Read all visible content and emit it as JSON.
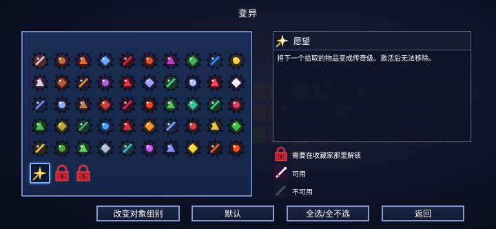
{
  "header": {
    "title": "变异"
  },
  "mutations": [
    [
      "dagger",
      "#c9c9d6",
      "#5a2a2a"
    ],
    [
      "pickaxe",
      "#c06a3a",
      "#3a1c2a"
    ],
    [
      "flame-axe",
      "#e07030",
      "#3a1a2a"
    ],
    [
      "sword-x",
      "#6aa8ff",
      "#1a2a4a"
    ],
    [
      "rune",
      "#d03040",
      "#3a1020"
    ],
    [
      "potion",
      "#e05030",
      "#3a1a1a"
    ],
    [
      "bow",
      "#c040c0",
      "#2a1a3a"
    ],
    [
      "orb",
      "#40b050",
      "#1a3a2a"
    ],
    [
      "shield",
      "#3a80ff",
      "#1a2a4a"
    ],
    [
      "bolt",
      "#ffd040",
      "#3a2a1a"
    ],
    [
      "fist",
      "#d8d8e0",
      "#3a1a3a"
    ],
    [
      "crossbow",
      "#b05a30",
      "#3a1a1a"
    ],
    [
      "gear",
      "#e09030",
      "#2a1a2a"
    ],
    [
      "axe",
      "#b060e0",
      "#2a1a3a"
    ],
    [
      "star",
      "#e03040",
      "#3a1020"
    ],
    [
      "claw",
      "#a0a0ff",
      "#1a1a3a"
    ],
    [
      "flask",
      "#40d080",
      "#1a3a2a"
    ],
    [
      "wings",
      "#b0c0ff",
      "#1a1a3a"
    ],
    [
      "target",
      "#ff4060",
      "#3a1020"
    ],
    [
      "skull",
      "#f0f0f0",
      "#2a1a3a"
    ],
    [
      "blade",
      "#6a90ff",
      "#1a2040"
    ],
    [
      "grenade",
      "#8ab0ff",
      "#1a2040"
    ],
    [
      "spear",
      "#c08050",
      "#2a1a2a"
    ],
    [
      "mask",
      "#d04040",
      "#3a1a1a"
    ],
    [
      "flame",
      "#d03060",
      "#3a1020"
    ],
    [
      "eye",
      "#ff4030",
      "#2a1a1a"
    ],
    [
      "skull-2",
      "#60c060",
      "#1a3a2a"
    ],
    [
      "tome",
      "#3ac0a0",
      "#1a3a3a"
    ],
    [
      "gem",
      "#3ad080",
      "#1a3a2a"
    ],
    [
      "heart",
      "#e04060",
      "#3a1a2a"
    ],
    [
      "bomb",
      "#40c060",
      "#1a3a1a"
    ],
    [
      "knife",
      "#c0a040",
      "#2a2a1a"
    ],
    [
      "hook",
      "#4ab060",
      "#1a3a2a"
    ],
    [
      "cauldron",
      "#40a0ff",
      "#1a2a4a"
    ],
    [
      "drop",
      "#e03040",
      "#3a1a1a"
    ],
    [
      "chevrons",
      "#ff9030",
      "#3a2a1a"
    ],
    [
      "tower",
      "#80a0ff",
      "#1a2a4a"
    ],
    [
      "poison",
      "#e04040",
      "#2a1a2a"
    ],
    [
      "boots",
      "#f0c040",
      "#2a2a1a"
    ],
    [
      "ring",
      "#40c050",
      "#1a3a1a"
    ],
    [
      "arrows",
      "#f0c040",
      "#2a2a1a"
    ],
    [
      "vine",
      "#50a040",
      "#1a2a1a"
    ],
    [
      "face",
      "#60d060",
      "#1a3a2a"
    ],
    [
      "ghost",
      "#b0c0d0",
      "#1a2a3a"
    ],
    [
      "crown",
      "#3ac0d0",
      "#1a3a3a"
    ],
    [
      "amulet",
      "#c060ff",
      "#2a1a3a"
    ],
    [
      "hammer",
      "#8090ff",
      "#1a1a3a"
    ],
    [
      "sun",
      "#ffd040",
      "#2a2a1a"
    ],
    [
      "bone",
      "#e06040",
      "#2a1a1a"
    ],
    [
      "flame-2",
      "#ff5020",
      "#2a1a1a"
    ]
  ],
  "bottom_row": [
    {
      "name": "wish-mutation-icon",
      "kind": "wish"
    },
    {
      "name": "locked-mutation-icon",
      "kind": "lock"
    },
    {
      "name": "locked-mutation-icon",
      "kind": "lock"
    }
  ],
  "selected": {
    "name": "愿望",
    "description": "将下一个拾取的物品变成传奇级。激活后无法移除。"
  },
  "legend": {
    "locked": "需要在收藏家那里解锁",
    "available": "可用",
    "unavailable": "不可用"
  },
  "buttons": {
    "change_group": "改变对象组别",
    "default": "默认",
    "select_all": "全选/全不选",
    "back": "返回"
  },
  "colors": {
    "panel_border": "#6b8bcf",
    "lock_red": "#c02030",
    "selection": "#7fb6ff"
  }
}
